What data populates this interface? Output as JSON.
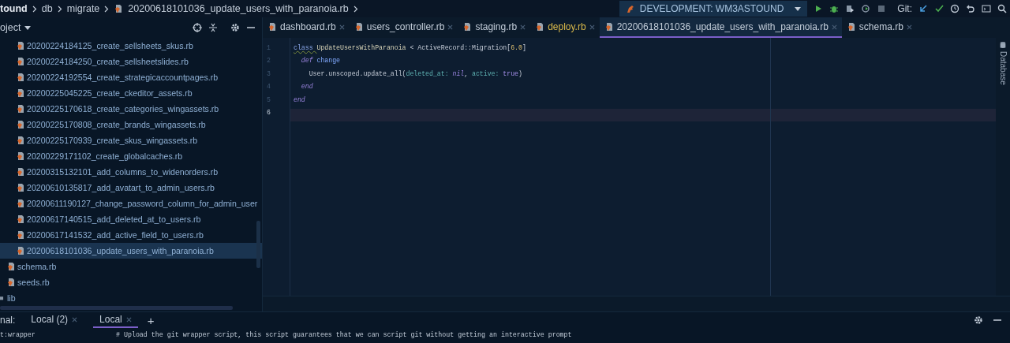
{
  "breadcrumb": [
    "tound",
    "db",
    "migrate",
    "20200618101036_update_users_with_paranoia.rb"
  ],
  "run_config": {
    "label": "DEVELOPMENT: WM3ASTOUND"
  },
  "git": {
    "label": "Git:"
  },
  "project_panel": {
    "title": "oject"
  },
  "tree": [
    {
      "children": [
        {
          "children": [
            {
              "label": "20200224184125_create_sellsheets_skus.rb",
              "kind": "file",
              "selected": false
            },
            {
              "label": "20200224184250_create_sellsheetslides.rb",
              "kind": "file",
              "selected": false
            },
            {
              "label": "20200224192554_create_strategicaccountpages.rb",
              "kind": "file",
              "selected": false
            },
            {
              "label": "20200225045225_create_ckeditor_assets.rb",
              "kind": "file",
              "selected": false
            },
            {
              "label": "20200225170618_create_categories_wingassets.rb",
              "kind": "file",
              "selected": false
            },
            {
              "label": "20200225170808_create_brands_wingassets.rb",
              "kind": "file",
              "selected": false
            },
            {
              "label": "20200225170939_create_skus_wingassets.rb",
              "kind": "file",
              "selected": false
            },
            {
              "label": "20200229171102_create_globalcaches.rb",
              "kind": "file",
              "selected": false
            },
            {
              "label": "20200315132101_add_columns_to_widenorders.rb",
              "kind": "file",
              "selected": false
            },
            {
              "label": "20200610135817_add_avatart_to_admin_users.rb",
              "kind": "file",
              "selected": false
            },
            {
              "label": "20200611190127_change_password_column_for_admin_user",
              "kind": "file",
              "selected": false
            },
            {
              "label": "20200617140515_add_deleted_at_to_users.rb",
              "kind": "file",
              "selected": false
            },
            {
              "label": "20200617141532_add_active_field_to_users.rb",
              "kind": "file",
              "selected": false
            },
            {
              "label": "20200618101036_update_users_with_paranoia.rb",
              "kind": "file",
              "selected": true
            }
          ]
        },
        {
          "label": "schema.rb",
          "kind": "file",
          "selected": false
        },
        {
          "label": "seeds.rb",
          "kind": "file",
          "selected": false
        }
      ]
    },
    {
      "label": "lib",
      "kind": "folder",
      "selected": false
    }
  ],
  "tabs": [
    {
      "label": "dashboard.rb",
      "selected": false,
      "modified": false
    },
    {
      "label": "users_controller.rb",
      "selected": false,
      "modified": false
    },
    {
      "label": "staging.rb",
      "selected": false,
      "modified": false
    },
    {
      "label": "deploy.rb",
      "selected": false,
      "modified": true
    },
    {
      "label": "20200618101036_update_users_with_paranoia.rb",
      "selected": true,
      "modified": false
    },
    {
      "label": "schema.rb",
      "selected": false,
      "modified": false
    }
  ],
  "editor": {
    "lines": [
      {
        "number": "1",
        "current": false,
        "tokens": [
          {
            "text": "class ",
            "kind": "keyword"
          },
          {
            "text": "UpdateUsersWithParanoia",
            "kind": "constant"
          },
          {
            "text": " < ActiveRecord::Migration[",
            "kind": "plain"
          },
          {
            "text": "6.0",
            "kind": "number"
          },
          {
            "text": "]",
            "kind": "plain"
          }
        ]
      },
      {
        "number": "2",
        "current": false,
        "tokens": [
          {
            "text": "  def ",
            "kind": "italic"
          },
          {
            "text": "change",
            "kind": "method"
          }
        ]
      },
      {
        "number": "3",
        "current": false,
        "tokens": [
          {
            "text": "    User.unscoped.update_all(",
            "kind": "plain"
          },
          {
            "text": "deleted_at: ",
            "kind": "symbol"
          },
          {
            "text": "nil",
            "kind": "italic"
          },
          {
            "text": ", ",
            "kind": "plain"
          },
          {
            "text": "active: ",
            "kind": "symbol"
          },
          {
            "text": "true",
            "kind": "literal"
          },
          {
            "text": ")",
            "kind": "plain"
          }
        ]
      },
      {
        "number": "4",
        "current": false,
        "tokens": [
          {
            "text": "  end",
            "kind": "italic"
          }
        ]
      },
      {
        "number": "5",
        "current": false,
        "tokens": [
          {
            "text": "end",
            "kind": "italic"
          }
        ]
      },
      {
        "number": "6",
        "current": true
      }
    ]
  },
  "side_strip": {
    "label": "Database"
  },
  "terminal": {
    "label": "nal:",
    "tabs": [
      {
        "label": "Local (2)",
        "selected": false
      },
      {
        "label": "Local",
        "selected": true
      }
    ],
    "add": "+",
    "lines": [
      {
        "command": "t:wrapper",
        "comment": "# Upload the git wrapper script, this script guarantees that we can script git without getting an interactive prompt"
      }
    ]
  }
}
